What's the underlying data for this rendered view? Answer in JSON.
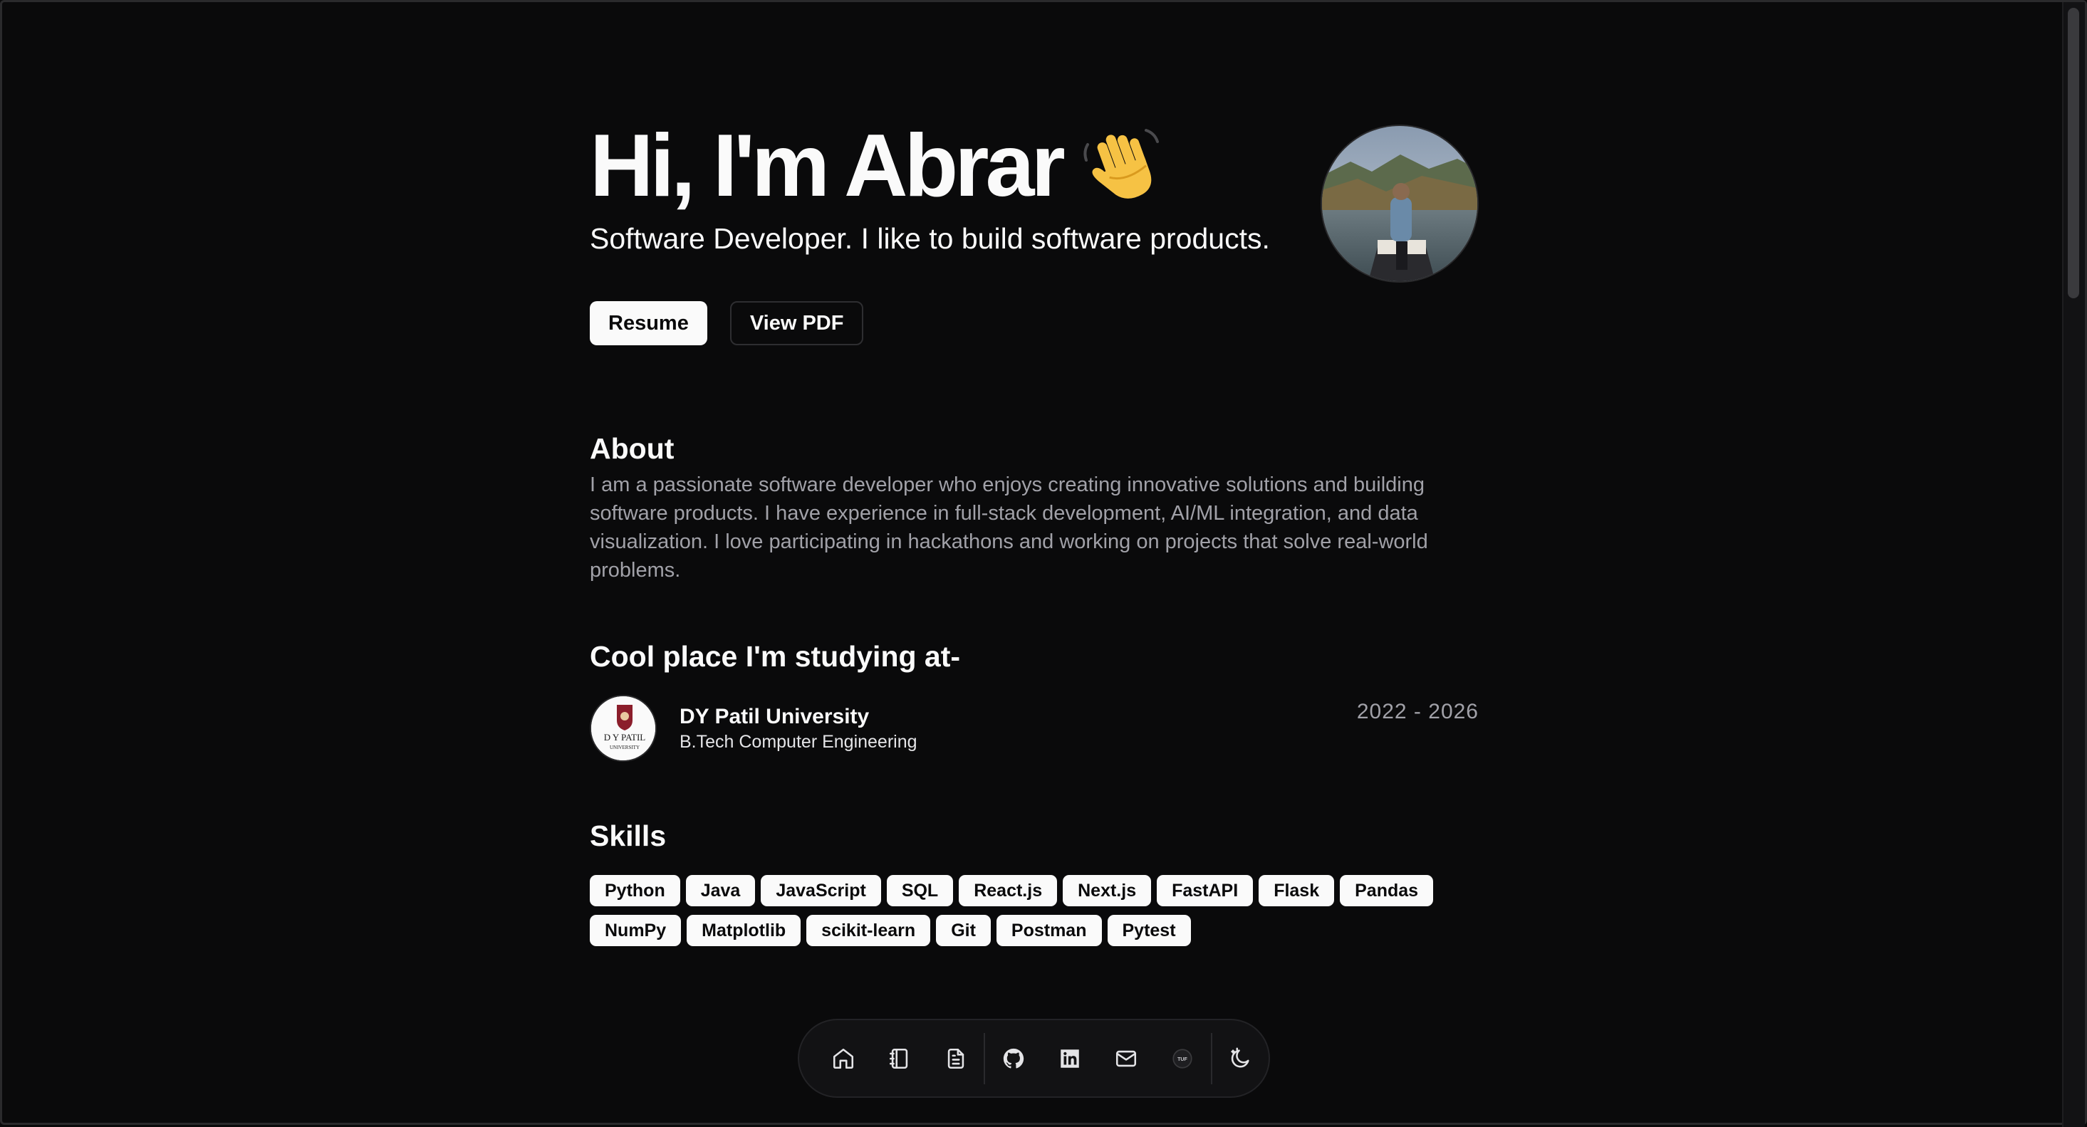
{
  "hero": {
    "title": "Hi, I'm Abrar",
    "subtitle": "Software Developer. I like to build software products."
  },
  "buttons": {
    "resume": "Resume",
    "view_pdf": "View PDF"
  },
  "about": {
    "title": "About",
    "text": "I am a passionate software developer who enjoys creating innovative solutions and building software products. I have experience in full-stack development, AI/ML integration, and data visualization. I love participating in hackathons and working on projects that solve real-world problems."
  },
  "education": {
    "title": "Cool place I'm studying at-",
    "school": "DY Patil University",
    "degree": "B.Tech Computer Engineering",
    "dates": "2022 - 2026",
    "logo_text": "D Y PATIL",
    "logo_subtext": "UNIVERSITY"
  },
  "skills": {
    "title": "Skills",
    "items": [
      "Python",
      "Java",
      "JavaScript",
      "SQL",
      "React.js",
      "Next.js",
      "FastAPI",
      "Flask",
      "Pandas",
      "NumPy",
      "Matplotlib",
      "scikit-learn",
      "Git",
      "Postman",
      "Pytest"
    ]
  },
  "dock": {
    "items": [
      "home-icon",
      "notebook-icon",
      "file-text-icon",
      "github-icon",
      "linkedin-icon",
      "mail-icon",
      "tuf-icon",
      "theme-toggle-icon"
    ],
    "tuf_label": "TUF"
  },
  "colors": {
    "background": "#0a0a0b",
    "foreground": "#fafafa",
    "muted": "#a1a1a8"
  }
}
